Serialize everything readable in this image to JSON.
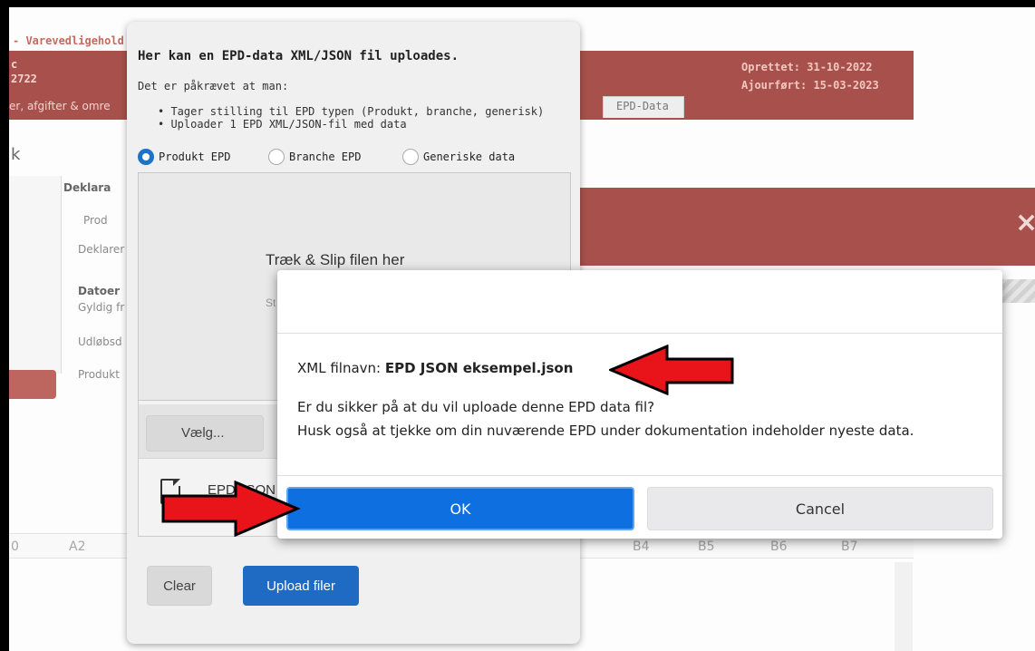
{
  "background": {
    "breadcrumb": "- Varevedligehold",
    "record_line1": "c",
    "record_number": "2722",
    "record_subtitle": "er, afgifter & omre",
    "created": "Oprettet: 31-10-2022",
    "updated": "Ajourført: 15-03-2023",
    "tab_epd": "EPD-Data",
    "side_letter": "k",
    "form_labels": [
      "Deklara",
      "Prod",
      "Deklarer",
      "Datoer",
      "Gyldig fr",
      "Udløbsd",
      "Produkt"
    ],
    "close_symbol": "×",
    "grid_columns_left": [
      "0",
      "A2"
    ],
    "grid_columns_right": [
      "B4",
      "B5",
      "B6",
      "B7"
    ]
  },
  "upload_dialog": {
    "title": "Her kan en EPD-data XML/JSON fil uploades.",
    "requirement_intro": "Det er påkrævet at man:",
    "requirements": [
      "Tager stilling til EPD typen (Produkt, branche, generisk)",
      "Uploader 1 EPD XML/JSON-fil med data"
    ],
    "radio_options": [
      "Produkt EPD",
      "Branche EPD",
      "Generiske data"
    ],
    "selected_option": "Produkt EPD",
    "drop_text": "Træk & Slip filen her",
    "drop_subtext": "St",
    "choose_button": "Vælg...",
    "file_name": "EPD JSON",
    "clear_button": "Clear",
    "upload_button": "Upload filer"
  },
  "confirm_dialog": {
    "filename_label": "XML filnavn:",
    "filename_value": "EPD JSON eksempel.json",
    "question": "Er du sikker på at du vil uploade denne EPD data fil?",
    "reminder": "Husk også at tjekke om din nuværende EPD under dokumentation indeholder nyeste data.",
    "ok_label": "OK",
    "cancel_label": "Cancel"
  },
  "colors": {
    "header_red": "#a8514c",
    "primary_blue": "#0d6fe0",
    "arrow_red": "#e8141a"
  }
}
